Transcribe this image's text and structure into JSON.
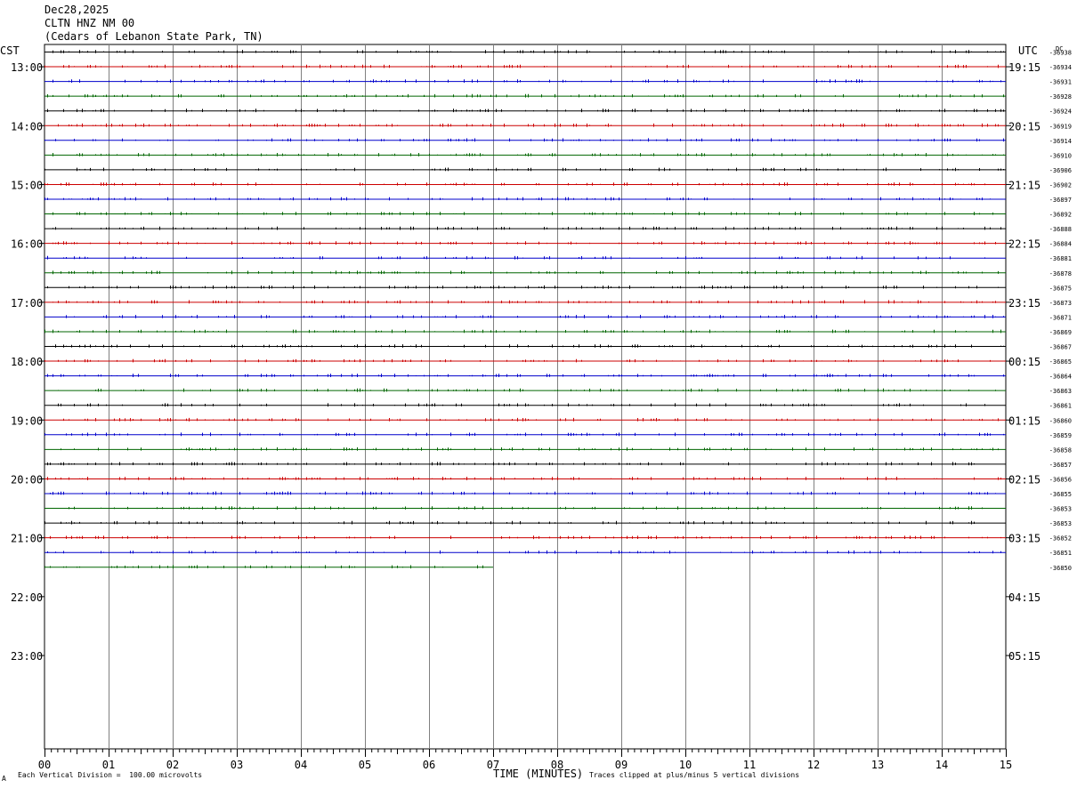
{
  "header": {
    "date": "Dec28,2025",
    "station": "CLTN HNZ NM 00",
    "location": "(Cedars of Lebanon State Park, TN)"
  },
  "left_zone_label": "CST",
  "right_zone_label": "UTC",
  "dc_header": "DC",
  "footer": {
    "scale_note": "Each Vertical Division =  100.00 microvolts",
    "clip_note": "Traces clipped at plus/minus 5 vertical divisions",
    "corner_mark": "A"
  },
  "colors": {
    "trace_cycle": [
      "#000000",
      "#cc0000",
      "#0000cc",
      "#006600"
    ],
    "grid": "#808080"
  },
  "chart_data": {
    "type": "line",
    "title": "",
    "xlabel": "TIME (MINUTES)",
    "ylabel": "",
    "xlim": [
      0,
      15
    ],
    "x_ticks": [
      "00",
      "01",
      "02",
      "03",
      "04",
      "05",
      "06",
      "07",
      "08",
      "09",
      "10",
      "11",
      "12",
      "13",
      "14",
      "15"
    ],
    "rows_per_hour": 4,
    "minutes_per_row": 15,
    "left_hour_labels": [
      "13:00",
      "14:00",
      "15:00",
      "16:00",
      "17:00",
      "18:00",
      "19:00",
      "20:00",
      "21:00",
      "22:00",
      "23:00"
    ],
    "right_hour_labels": [
      "19:15",
      "20:15",
      "21:15",
      "22:15",
      "23:15",
      "00:15",
      "01:15",
      "02:15",
      "03:15",
      "04:15",
      "05:15"
    ],
    "first_row_hour_offset": 0.25,
    "dc_offsets": [
      "-36938",
      "-36934",
      "-36931",
      "-36928",
      "-36924",
      "-36919",
      "-36914",
      "-36910",
      "-36906",
      "-36902",
      "-36897",
      "-36892",
      "-36888",
      "-36884",
      "-36881",
      "-36878",
      "-36875",
      "-36873",
      "-36871",
      "-36869",
      "-36867",
      "-36865",
      "-36864",
      "-36863",
      "-36861",
      "-36860",
      "-36859",
      "-36858",
      "-36857",
      "-36856",
      "-36855",
      "-36853",
      "-36853",
      "-36852",
      "-36851",
      "-36850"
    ],
    "trace_count": 36,
    "last_trace_end_minute": 7.0,
    "grid": true
  }
}
